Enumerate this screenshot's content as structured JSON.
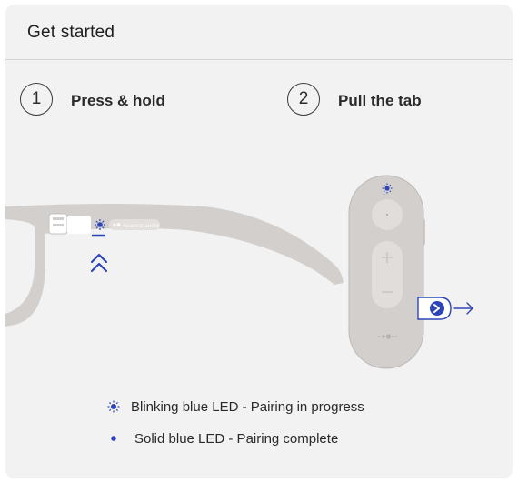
{
  "card": {
    "title": "Get started"
  },
  "steps": [
    {
      "number": "1",
      "label": "Press & hold"
    },
    {
      "number": "2",
      "label": "Pull the tab"
    }
  ],
  "glasses": {
    "temple_brand_text": "nuance audio"
  },
  "legend": [
    {
      "icon": "blinking-led-icon",
      "text": "Blinking blue LED - Pairing in progress"
    },
    {
      "icon": "solid-led-dot-icon",
      "text": "Solid blue LED - Pairing complete"
    }
  ],
  "colors": {
    "accent_blue": "#2d45b8",
    "card_background": "#f2f2f2",
    "device_gray": "#d2cfcd"
  }
}
